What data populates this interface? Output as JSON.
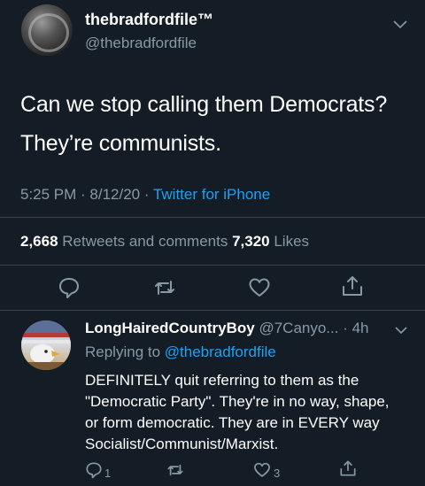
{
  "tweet": {
    "display_name": "thebradfordfile™",
    "handle": "@thebradfordfile",
    "line1": "Can we stop calling them Democrats?",
    "line2": "They’re communists.",
    "time_date": "5:25 PM · 8/12/20 · ",
    "source": "Twitter for iPhone",
    "retweets_count": "2,668",
    "retweets_label": " Retweets and comments ",
    "likes_count": "7,320",
    "likes_label": " Likes"
  },
  "actions": [
    "comment-icon",
    "retweet-icon",
    "heart-icon",
    "share-icon"
  ],
  "reply": {
    "display_name": "LongHairedCountryBoy",
    "handle_time": " @7Canyo... · 4h",
    "replying_prefix": "Replying to ",
    "replying_to": "@thebradfordfile",
    "text": "DEFINITELY quit referring to them as the \"Democratic Party\". They're in no way, shape, or form democratic. They are in EVERY way Socialist/Communist/Marxist.",
    "reply_count": "1",
    "like_count": "3"
  },
  "colors": {
    "background": "#141d26",
    "secondary_text": "#8899a6",
    "link": "#1da1f2",
    "divider": "#38444d"
  }
}
